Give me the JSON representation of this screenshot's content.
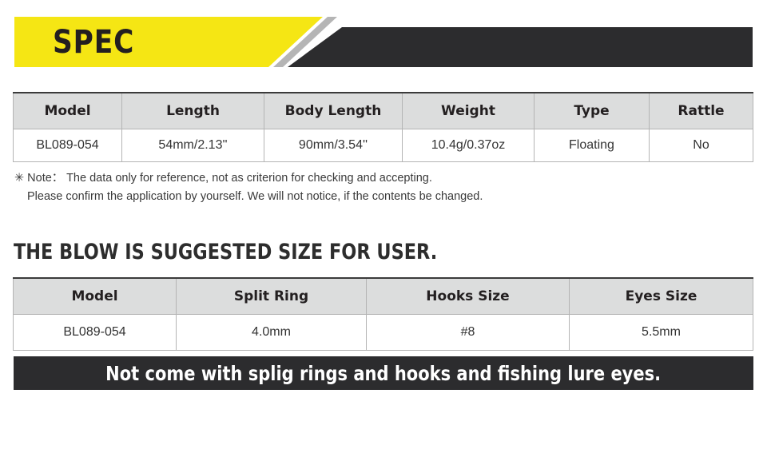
{
  "banner": {
    "title": "SPEC",
    "yellow_color": "#f5e614",
    "dark_color": "#2c2c2e",
    "stripe_color": "#b5b5b5"
  },
  "spec_table": {
    "headers": [
      "Model",
      "Length",
      "Body Length",
      "Weight",
      "Type",
      "Rattle"
    ],
    "rows": [
      [
        "BL089-054",
        "54mm/2.13''",
        "90mm/3.54''",
        "10.4g/0.37oz",
        "Floating",
        "No"
      ]
    ]
  },
  "note": {
    "line1": "✳ Note： The data only for reference, not as criterion for checking and accepting.",
    "line2": "Please confirm the application by yourself.  We will not notice, if the contents be changed."
  },
  "headline": "THE BLOW IS SUGGESTED SIZE FOR USER.",
  "suggested_table": {
    "headers": [
      "Model",
      "Split Ring",
      "Hooks Size",
      "Eyes Size"
    ],
    "rows": [
      [
        "BL089-054",
        "4.0mm",
        "#8",
        "5.5mm"
      ]
    ]
  },
  "footer": {
    "text": "Not come with splig rings and hooks and fishing lure eyes."
  }
}
